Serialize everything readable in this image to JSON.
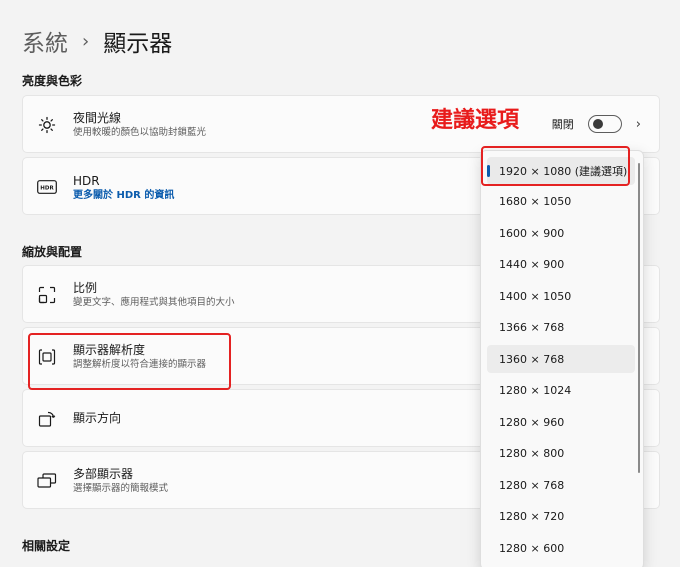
{
  "header": {
    "breadcrumb_parent": "系統",
    "separator": "›",
    "page_title": "顯示器"
  },
  "sections": {
    "brightness_color": "亮度與色彩",
    "scale_layout": "縮放與配置",
    "related": "相關設定"
  },
  "night_light": {
    "title": "夜間光線",
    "subtitle": "使用較暖的顏色以協助封鎖藍光",
    "state": "關閉",
    "enabled": false
  },
  "hdr": {
    "title": "HDR",
    "link": "更多關於 HDR 的資訊"
  },
  "scale": {
    "title": "比例",
    "subtitle": "變更文字、應用程式與其他項目的大小"
  },
  "resolution": {
    "title": "顯示器解析度",
    "subtitle": "調整解析度以符合連接的顯示器"
  },
  "orientation": {
    "title": "顯示方向"
  },
  "multi_display": {
    "title": "多部顯示器",
    "subtitle": "選擇顯示器的簡報模式"
  },
  "annotation": {
    "text": "建議選項"
  },
  "resolution_options": [
    "1920 × 1080 (建議選項)",
    "1680 × 1050",
    "1600 × 900",
    "1440 × 900",
    "1400 × 1050",
    "1366 × 768",
    "1360 × 768",
    "1280 × 1024",
    "1280 × 960",
    "1280 × 800",
    "1280 × 768",
    "1280 × 720",
    "1280 × 600"
  ],
  "colors": {
    "accent": "#0b5cad",
    "annotation_red": "#e81b1b"
  }
}
